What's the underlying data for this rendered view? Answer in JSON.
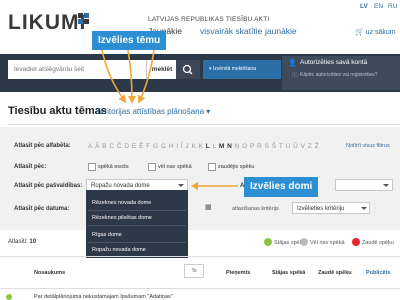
{
  "header": {
    "logo_text": "LIKUMI",
    "tagline": "LATVIJAS REPUBLIKAS TIESĪBU AKTI",
    "languages": [
      "LV",
      "EN",
      "RU"
    ],
    "nav": [
      "Jaunākie",
      "visvairāk skatītie",
      "jaunākie"
    ],
    "cart_label": "uz sākum"
  },
  "search": {
    "placeholder": "Ievadiet atslēgvārdu šeit",
    "button_label": "meklēt",
    "extended_label": "Izvērstā meklēšana"
  },
  "auth": {
    "title": "Autorizēties savā kontā",
    "subtitle": "Kāpēc autorizēties vai reģistrēties?"
  },
  "callouts": {
    "topic": "Izvēlies tēmu",
    "authority": "Izvēlies domi"
  },
  "page": {
    "title": "Tiesību aktu tēmas",
    "topic_selected": "Teritorijas attīstības plānošana"
  },
  "filters": {
    "alphabet_label": "Atlasīt pēc alfabēta:",
    "letters": [
      "A",
      "Ā",
      "B",
      "C",
      "Č",
      "D",
      "E",
      "Ē",
      "F",
      "G",
      "Ģ",
      "H",
      "I",
      "Ī",
      "J",
      "K",
      "Ķ",
      "L",
      "Ļ",
      "M",
      "N",
      "Ņ",
      "O",
      "P",
      "R",
      "S",
      "Š",
      "T",
      "U",
      "Ū",
      "V",
      "Z",
      "Ž"
    ],
    "bold_letters": [
      "L",
      "M",
      "N"
    ],
    "clear_label": "Notīrīt visus filtrus",
    "status_label": "Atlasīt pēc:",
    "status_options": [
      "spēkā esošs",
      "vēl nav spēkā",
      "zaudējis spēku"
    ],
    "authority_label": "Atlasīt pēc pašvaldības:",
    "authority_selected": "Ropažu novada dome",
    "authority_options": [
      "Rēzeknes novada dome",
      "Rēzeknes pilsētas dome",
      "Rīgas dome",
      "Ropažu novada dome"
    ],
    "right_select_label": "Atla",
    "date_label": "Atlasīt pēc datuma:",
    "date_criteria_label": "atlasīšanas kritērijs",
    "date_criteria_select": "Izvēlieties kritēriju"
  },
  "results": {
    "count_label": "Atlasīti:",
    "count": "10",
    "legend": [
      "Stājas spēkā",
      "Vēl nav spēkā",
      "Zaudē spēku"
    ],
    "legend_colors": [
      "#8cc63f",
      "#bbbbbb",
      "#e2262e"
    ],
    "columns": [
      "Nosaukums",
      "Pieņemts",
      "Stājas spēkā",
      "Zaudē spēku",
      "Publicēts"
    ],
    "ts_label": "Ts",
    "first_row_text": "Par detālplānojuma nekustamajam īpašumam \"Adatiņas\""
  },
  "colors": {
    "accent": "#2c6ea6",
    "band": "#2d3848",
    "callout": "#2c8fd3",
    "arrow": "#f0a63a"
  }
}
